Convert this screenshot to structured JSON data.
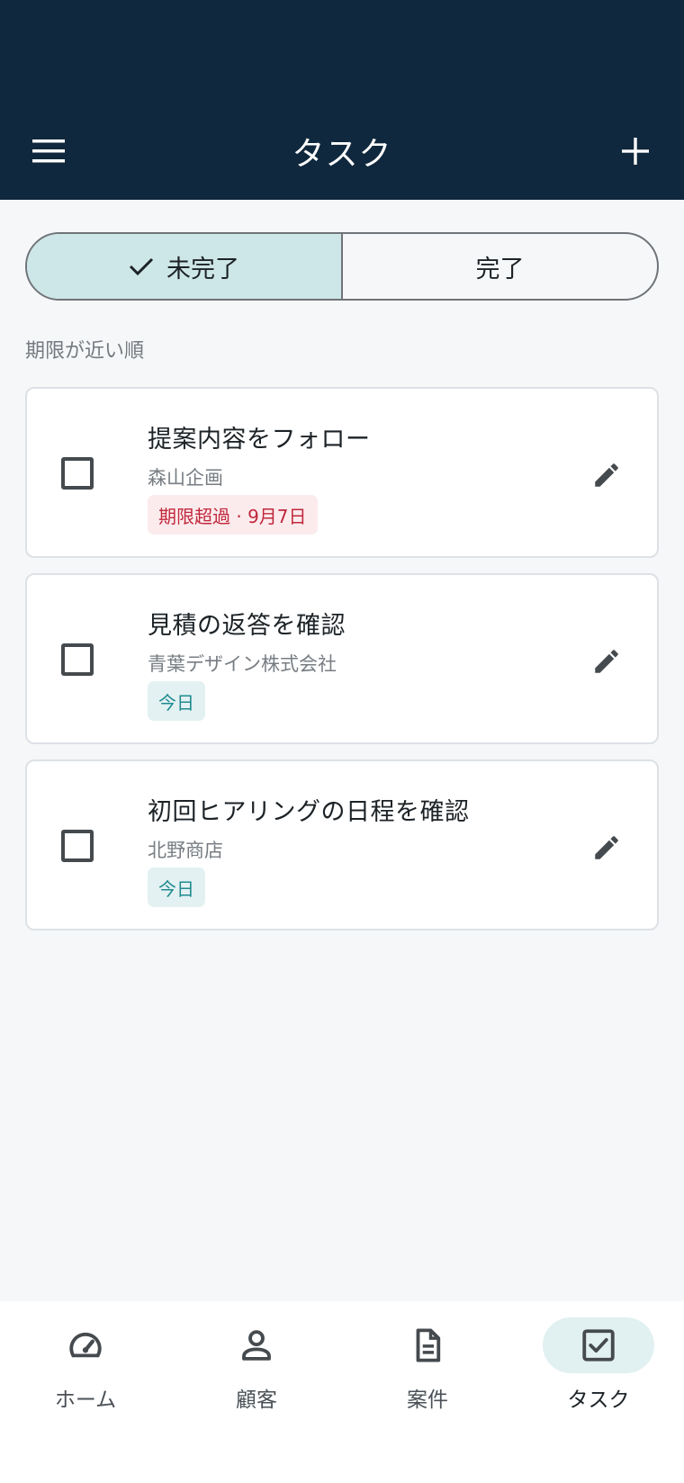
{
  "header": {
    "title": "タスク",
    "menu_icon": "menu-icon",
    "add_icon": "plus-icon"
  },
  "filter": {
    "incomplete_label": "未完了",
    "complete_label": "完了",
    "selected": "未完了"
  },
  "sort_label": "期限が近い順",
  "tasks": [
    {
      "title": "提案内容をフォロー",
      "client": "森山企画",
      "due": "期限超過 · 9月7日",
      "due_status": "overdue",
      "checked": false
    },
    {
      "title": "見積の返答を確認",
      "client": "青葉デザイン株式会社",
      "due": "今日",
      "due_status": "today",
      "checked": false
    },
    {
      "title": "初回ヒアリングの日程を確認",
      "client": "北野商店",
      "due": "今日",
      "due_status": "today",
      "checked": false
    }
  ],
  "nav": {
    "items": [
      {
        "label": "ホーム",
        "icon": "speedometer-icon"
      },
      {
        "label": "顧客",
        "icon": "person-icon"
      },
      {
        "label": "案件",
        "icon": "document-icon"
      },
      {
        "label": "タスク",
        "icon": "checkbox-icon"
      }
    ],
    "active": "タスク"
  },
  "colors": {
    "header_bg": "#10283d",
    "accent": "#cde6e8",
    "overdue_text": "#c0283c",
    "overdue_bg": "#fcebed",
    "today_text": "#1f8a90",
    "today_bg": "#e3f1f2"
  }
}
